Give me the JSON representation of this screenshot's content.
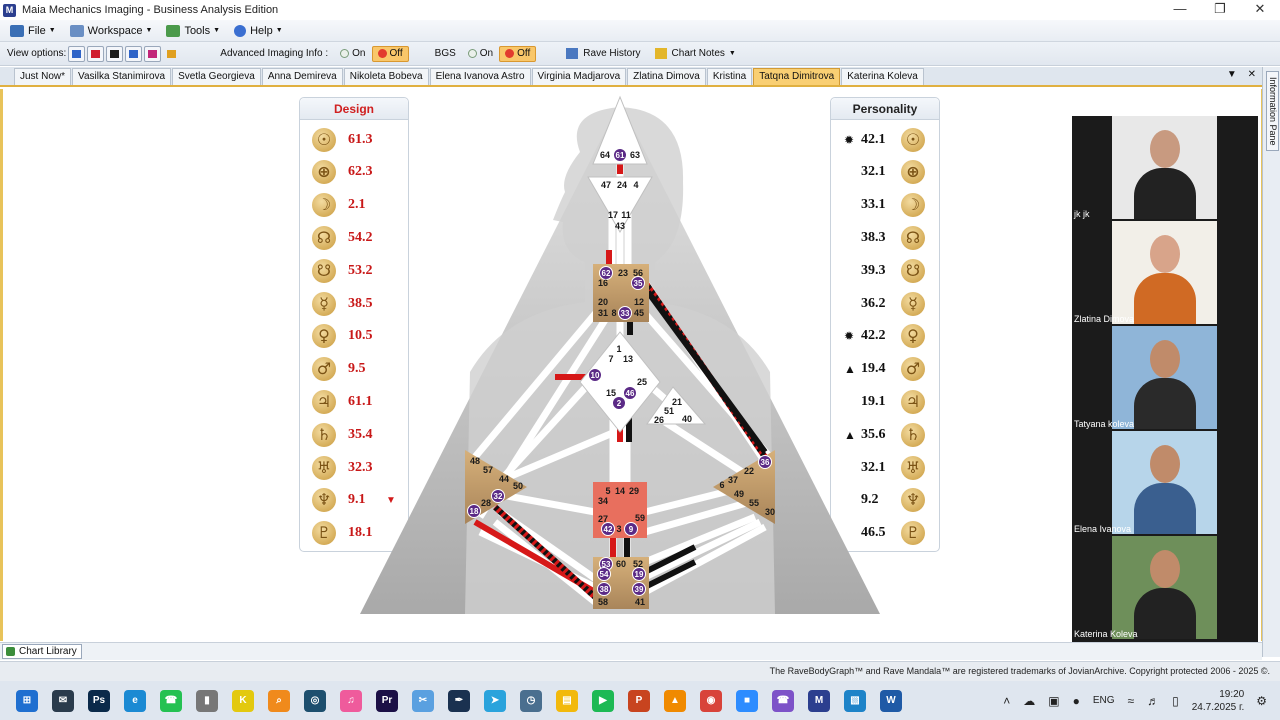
{
  "window": {
    "app_icon": "M",
    "title": "Maia Mechanics Imaging - Business Analysis Edition",
    "minimize": "—",
    "maximize": "❐",
    "close": "✕"
  },
  "menu": [
    {
      "label": "File",
      "icon": "file-icon",
      "color": "#3a6fb5"
    },
    {
      "label": "Workspace",
      "icon": "workspace-icon",
      "color": "#6a8fc4"
    },
    {
      "label": "Tools",
      "icon": "tools-icon",
      "color": "#4b9a4b"
    },
    {
      "label": "Help",
      "icon": "help-icon",
      "color": "#3b6fd1"
    }
  ],
  "toolbar": {
    "view_options_label": "View options:",
    "view_option_colors": [
      "#2f64c8",
      "#d01d2f",
      "#1a1a1a",
      "#2f64c8",
      "#c2267a",
      "#e0a020"
    ],
    "imaging_label": "Advanced Imaging Info :",
    "imaging_on": "On",
    "imaging_off": "Off",
    "bgs_label": "BGS",
    "bgs_on": "On",
    "bgs_off": "Off",
    "rave_history": "Rave History",
    "chart_notes": "Chart Notes"
  },
  "tabs": [
    "Just Now*",
    "Vasilka Stanimirova",
    "Svetla Georgieva",
    "Anna Demireva",
    "Nikoleta Bobeva",
    "Elena Ivanova Astro",
    "Virginia Madjarova",
    "Zlatina Dimova",
    "Kristina",
    "Tatqna Dimitrova",
    "Katerina Koleva"
  ],
  "active_tab": "Tatqna Dimitrova",
  "tabs_menu": "▼",
  "tabs_close": "✕",
  "info_pane_label": "Information Pane",
  "design": {
    "header": "Design",
    "rows": [
      {
        "planet": "sun",
        "glyph": "☉",
        "value": "61.3",
        "mark": ""
      },
      {
        "planet": "earth",
        "glyph": "⊕",
        "value": "62.3",
        "mark": ""
      },
      {
        "planet": "moon",
        "glyph": "☽",
        "value": "2.1",
        "mark": ""
      },
      {
        "planet": "north-node",
        "glyph": "☊",
        "value": "54.2",
        "mark": ""
      },
      {
        "planet": "south-node",
        "glyph": "☋",
        "value": "53.2",
        "mark": ""
      },
      {
        "planet": "mercury",
        "glyph": "☿",
        "value": "38.5",
        "mark": ""
      },
      {
        "planet": "venus",
        "glyph": "♀",
        "value": "10.5",
        "mark": ""
      },
      {
        "planet": "mars",
        "glyph": "♂",
        "value": "9.5",
        "mark": ""
      },
      {
        "planet": "jupiter",
        "glyph": "♃",
        "value": "61.1",
        "mark": ""
      },
      {
        "planet": "saturn",
        "glyph": "♄",
        "value": "35.4",
        "mark": ""
      },
      {
        "planet": "uranus",
        "glyph": "♅",
        "value": "32.3",
        "mark": ""
      },
      {
        "planet": "neptune",
        "glyph": "♆",
        "value": "9.1",
        "mark": "▼"
      },
      {
        "planet": "pluto",
        "glyph": "♇",
        "value": "18.1",
        "mark": ""
      }
    ]
  },
  "personality": {
    "header": "Personality",
    "rows": [
      {
        "planet": "sun",
        "glyph": "☉",
        "value": "42.1",
        "mark": "✹"
      },
      {
        "planet": "earth",
        "glyph": "⊕",
        "value": "32.1",
        "mark": ""
      },
      {
        "planet": "moon",
        "glyph": "☽",
        "value": "33.1",
        "mark": ""
      },
      {
        "planet": "north-node",
        "glyph": "☊",
        "value": "38.3",
        "mark": ""
      },
      {
        "planet": "south-node",
        "glyph": "☋",
        "value": "39.3",
        "mark": ""
      },
      {
        "planet": "mercury",
        "glyph": "☿",
        "value": "36.2",
        "mark": ""
      },
      {
        "planet": "venus",
        "glyph": "♀",
        "value": "42.2",
        "mark": "✹"
      },
      {
        "planet": "mars",
        "glyph": "♂",
        "value": "19.4",
        "mark": "▲"
      },
      {
        "planet": "jupiter",
        "glyph": "♃",
        "value": "19.1",
        "mark": ""
      },
      {
        "planet": "saturn",
        "glyph": "♄",
        "value": "35.6",
        "mark": "▲"
      },
      {
        "planet": "uranus",
        "glyph": "♅",
        "value": "32.1",
        "mark": ""
      },
      {
        "planet": "neptune",
        "glyph": "♆",
        "value": "9.2",
        "mark": ""
      },
      {
        "planet": "pluto",
        "glyph": "♇",
        "value": "46.5",
        "mark": ""
      }
    ]
  },
  "bodygraph": {
    "head": [
      "64",
      "61",
      "63"
    ],
    "ajna": [
      "47",
      "24",
      "4",
      "17",
      "11",
      "43"
    ],
    "throat": [
      "62",
      "23",
      "56",
      "16",
      "35",
      "20",
      "12",
      "31",
      "8",
      "33",
      "45"
    ],
    "g": [
      "1",
      "7",
      "13",
      "10",
      "15",
      "46",
      "25",
      "2"
    ],
    "heart": [
      "21",
      "51",
      "26",
      "40"
    ],
    "spleen": [
      "48",
      "57",
      "44",
      "50",
      "32",
      "28",
      "18"
    ],
    "solar_plexus": [
      "36",
      "22",
      "6",
      "37",
      "49",
      "55",
      "30"
    ],
    "sacral": [
      "5",
      "14",
      "29",
      "34",
      "27",
      "59",
      "42",
      "3",
      "9"
    ],
    "root": [
      "53",
      "60",
      "52",
      "54",
      "19",
      "38",
      "39",
      "58",
      "41"
    ],
    "activated_gates": [
      "61",
      "62",
      "35",
      "33",
      "10",
      "46",
      "2",
      "36",
      "32",
      "18",
      "42",
      "9",
      "53",
      "54",
      "19",
      "38",
      "39"
    ]
  },
  "participants": [
    {
      "name": "jk jk",
      "skin": "#c89a80",
      "bg": "#e8e8e8",
      "shirt": "#222222"
    },
    {
      "name": "Zlatina Dimova",
      "skin": "#d8a48a",
      "bg": "#f2efe8",
      "shirt": "#d06a24"
    },
    {
      "name": "Tatyana koleva",
      "skin": "#c08b6a",
      "bg": "#8fb5d8",
      "shirt": "#2a2a2a"
    },
    {
      "name": "Elena Ivanova",
      "skin": "#c08b6a",
      "bg": "#b7d5ea",
      "shirt": "#3a5f8f"
    },
    {
      "name": "Katerina Koleva",
      "skin": "#c08b6a",
      "bg": "#6e8f5a",
      "shirt": "#222222"
    }
  ],
  "chart_library": "Chart Library",
  "copyright": "The RaveBodyGraph™ and Rave Mandala™ are registered trademarks of JovianArchive. Copyright protected 2006 - 2025 ©.",
  "taskbar": {
    "apps": [
      {
        "name": "start",
        "color": "#1f6fd0",
        "glyph": "⊞"
      },
      {
        "name": "mail",
        "color": "#2a3b4c",
        "glyph": "✉"
      },
      {
        "name": "photoshop",
        "color": "#0b2a4a",
        "glyph": "Ps"
      },
      {
        "name": "edge",
        "color": "#1b8ad3",
        "glyph": "e"
      },
      {
        "name": "whatsapp",
        "color": "#25c152",
        "glyph": "☎"
      },
      {
        "name": "microphone",
        "color": "#777777",
        "glyph": "▮"
      },
      {
        "name": "kiler",
        "color": "#e3c90f",
        "glyph": "K"
      },
      {
        "name": "search",
        "color": "#f08a1c",
        "glyph": "⌕"
      },
      {
        "name": "xbox",
        "color": "#1d4f6e",
        "glyph": "◎"
      },
      {
        "name": "music",
        "color": "#ef5b9c",
        "glyph": "♫"
      },
      {
        "name": "premiere",
        "color": "#1c1046",
        "glyph": "Pr"
      },
      {
        "name": "snipping",
        "color": "#5aa0e0",
        "glyph": "✂"
      },
      {
        "name": "pen",
        "color": "#1a3150",
        "glyph": "✒"
      },
      {
        "name": "telegram",
        "color": "#2aa3dc",
        "glyph": "➤"
      },
      {
        "name": "clock",
        "color": "#4a6f8f",
        "glyph": "◷"
      },
      {
        "name": "explorer",
        "color": "#f2b90c",
        "glyph": "▤"
      },
      {
        "name": "spotify",
        "color": "#1db954",
        "glyph": "▶"
      },
      {
        "name": "powerpoint",
        "color": "#c8441f",
        "glyph": "P"
      },
      {
        "name": "vlc",
        "color": "#f08a00",
        "glyph": "▲"
      },
      {
        "name": "chrome",
        "color": "#d8433a",
        "glyph": "◉"
      },
      {
        "name": "zoom",
        "color": "#2d8cff",
        "glyph": "■"
      },
      {
        "name": "viber",
        "color": "#7d52c8",
        "glyph": "☎"
      },
      {
        "name": "maia",
        "color": "#2c3f8f",
        "glyph": "M"
      },
      {
        "name": "image-viewer",
        "color": "#1d83c8",
        "glyph": "▧"
      },
      {
        "name": "word",
        "color": "#1f5aa6",
        "glyph": "W"
      }
    ],
    "tray_up": "˄",
    "language": "ENG",
    "time": "19:20",
    "date": "24.7.2025 г."
  }
}
